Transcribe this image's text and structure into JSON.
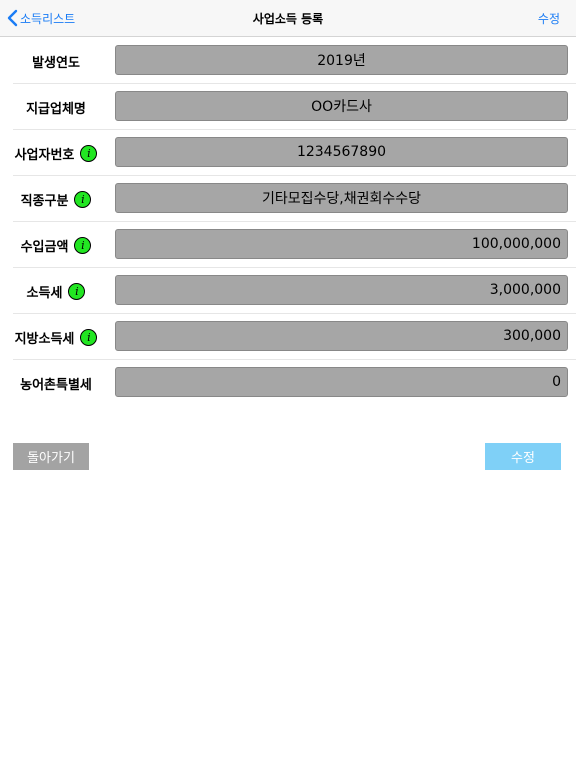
{
  "nav": {
    "back_label": "소득리스트",
    "title": "사업소득 등록",
    "edit_label": "수정"
  },
  "form": {
    "rows": [
      {
        "label": "발생연도",
        "value": "2019년",
        "align": "center",
        "info": false
      },
      {
        "label": "지급업체명",
        "value": "OO카드사",
        "align": "center",
        "info": false
      },
      {
        "label": "사업자번호",
        "value": "1234567890",
        "align": "center",
        "info": true
      },
      {
        "label": "직종구분",
        "value": "기타모집수당,채권회수수당",
        "align": "center",
        "info": true
      },
      {
        "label": "수입금액",
        "value": "100,000,000",
        "align": "right",
        "info": true
      },
      {
        "label": "소득세",
        "value": "3,000,000",
        "align": "right",
        "info": true
      },
      {
        "label": "지방소득세",
        "value": "300,000",
        "align": "right",
        "info": true
      },
      {
        "label": "농어촌특별세",
        "value": "0",
        "align": "right",
        "info": false
      }
    ],
    "info_glyph": "i"
  },
  "buttons": {
    "back_label": "돌아가기",
    "edit_label": "수정"
  },
  "colors": {
    "accent": "#1a7cf5",
    "field_bg": "#a6a6a6",
    "info_icon": "#22e622",
    "back_button": "#a3a3a3",
    "edit_button": "#7fd0f7"
  }
}
